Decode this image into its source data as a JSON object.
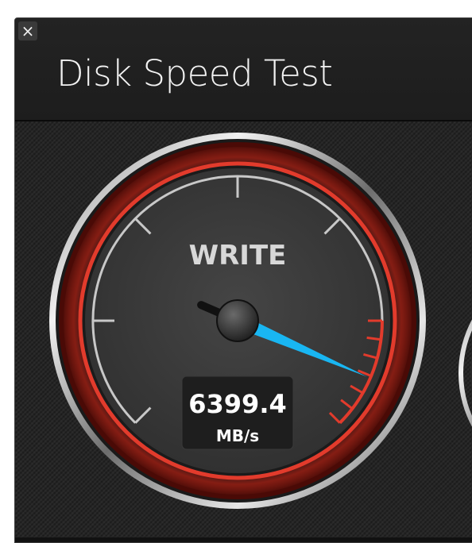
{
  "window": {
    "title": "Disk Speed Test",
    "close_glyph": "×"
  },
  "gauge": {
    "label": "WRITE",
    "value": "6399.4",
    "unit": "MB/s",
    "needle_color": "#19b6f2",
    "ring_color": "#e23b2c",
    "level_fraction": 0.92
  },
  "icons": {
    "close": "close-icon"
  }
}
